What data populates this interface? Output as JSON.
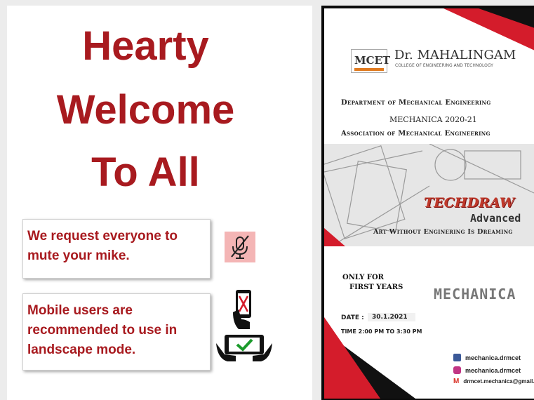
{
  "welcome": {
    "line1": "Hearty",
    "line2": "Welcome",
    "line3": "To All",
    "color": "#a81a1f"
  },
  "notices": {
    "mute": "We request everyone to mute your mike.",
    "mobile": "Mobile users are recommended to use in landscape mode."
  },
  "icons": {
    "mute": "microphone-muted-icon",
    "mobile": "phone-portrait-crossed-icon",
    "landscape": "phone-landscape-check-icon"
  },
  "poster": {
    "college_logo_text": "MCET",
    "college_name": "Dr. MAHALINGAM",
    "college_subtitle": "COLLEGE OF ENGINEERING AND TECHNOLOGY",
    "department": "Department of Mechanical Engineering",
    "event": "MECHANICA 2020-21",
    "association": "Association of Mechanical Engineering",
    "title": "TECHDRAW",
    "subtitle": "Advanced",
    "tagline": "Art Without Enginering Is Dreaming",
    "only_for": "ONLY FOR",
    "audience": "FIRST YEARS",
    "brand": "MECHANICA",
    "date_label": "DATE :",
    "date_value": "30.1.2021",
    "time": "TIME  2:00 PM  TO 3:30 PM",
    "facebook": "mechanica.drmcet",
    "instagram": "mechanica.drmcet",
    "email": "drmcet.mechanica@gmail.c",
    "accent": "#d41c2b"
  }
}
